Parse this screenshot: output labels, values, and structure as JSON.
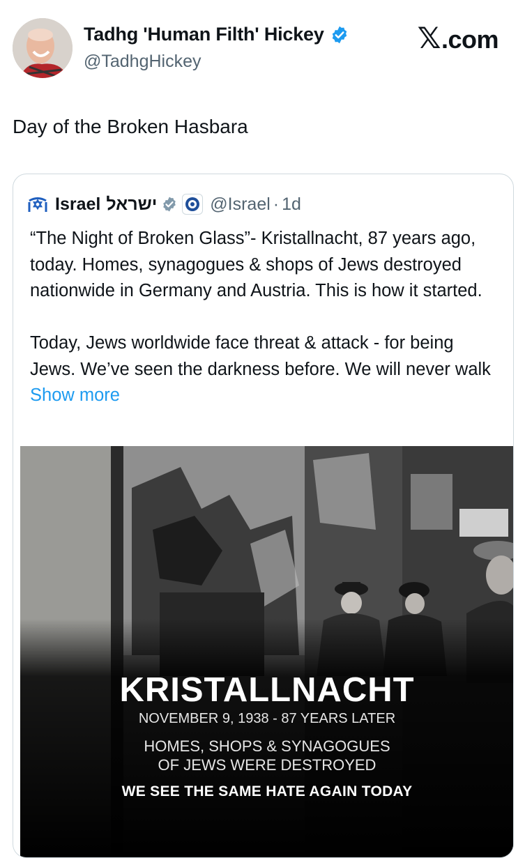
{
  "author": {
    "name": "Tadhg 'Human Filth' Hickey",
    "handle": "@TadhgHickey"
  },
  "site": {
    "logo_icon": "x-logo-icon",
    "logo_text": ".com"
  },
  "tweet": {
    "text": "Day of the Broken Hasbara"
  },
  "quoted": {
    "name": "Israel",
    "name_hebrew": "ישראל",
    "handle": "@Israel",
    "separator": "·",
    "time": "1d",
    "paragraph1": "“The Night of Broken Glass”- Kristallnacht, 87 years ago, today. Homes, synagogues & shops of Jews destroyed nationwide in Germany and Austria. This is how it started.",
    "paragraph2": "Today, Jews worldwide face threat & attack - for being Jews. We’ve seen the darkness before. We will never walk",
    "show_more": "Show more",
    "image": {
      "title": "KRISTALLNACHT",
      "date": "NOVEMBER 9, 1938 - 87 YEARS LATER",
      "line1": "HOMES, SHOPS & SYNAGOGUES",
      "line2": "OF JEWS WERE DESTROYED",
      "bottom": "WE SEE THE SAME HATE AGAIN TODAY"
    }
  },
  "colors": {
    "verified": "#1d9bf0",
    "link": "#1d9bf0",
    "secondary_text": "#536471",
    "border": "#cfd9de"
  }
}
